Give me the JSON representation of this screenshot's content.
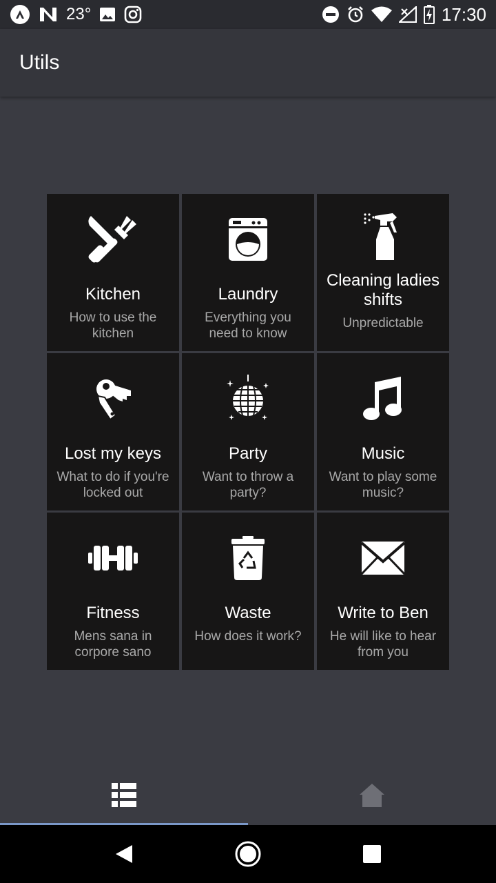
{
  "status_bar": {
    "temperature": "23°",
    "time": "17:30",
    "icons": [
      "app-logo-icon",
      "n-logo-icon",
      "image-icon",
      "instagram-icon",
      "do-not-disturb-icon",
      "alarm-icon",
      "wifi-icon",
      "signal-icon",
      "battery-charging-icon"
    ]
  },
  "app_bar": {
    "title": "Utils"
  },
  "tiles": [
    {
      "title": "Kitchen",
      "subtitle": "How to use the kitchen",
      "icon": "kitchen-utensils-icon"
    },
    {
      "title": "Laundry",
      "subtitle": "Everything you need to know",
      "icon": "washing-machine-icon"
    },
    {
      "title": "Cleaning ladies shifts",
      "subtitle": "Unpredictable",
      "icon": "spray-bottle-icon"
    },
    {
      "title": "Lost my keys",
      "subtitle": "What to do if you're locked out",
      "icon": "keys-icon"
    },
    {
      "title": "Party",
      "subtitle": "Want to throw a party?",
      "icon": "disco-ball-icon"
    },
    {
      "title": "Music",
      "subtitle": "Want to play some music?",
      "icon": "music-note-icon"
    },
    {
      "title": "Fitness",
      "subtitle": "Mens sana in corpore sano",
      "icon": "dumbbell-icon"
    },
    {
      "title": "Waste",
      "subtitle": "How does it work?",
      "icon": "recycle-bin-icon"
    },
    {
      "title": "Write to Ben",
      "subtitle": "He will like to hear from you",
      "icon": "envelope-icon"
    }
  ],
  "bottom_nav": {
    "tabs": [
      {
        "icon": "list-icon",
        "active": true
      },
      {
        "icon": "home-icon",
        "active": false
      }
    ]
  },
  "colors": {
    "background": "#3a3b42",
    "tile": "#171616",
    "active_indicator": "#7b98c8"
  }
}
